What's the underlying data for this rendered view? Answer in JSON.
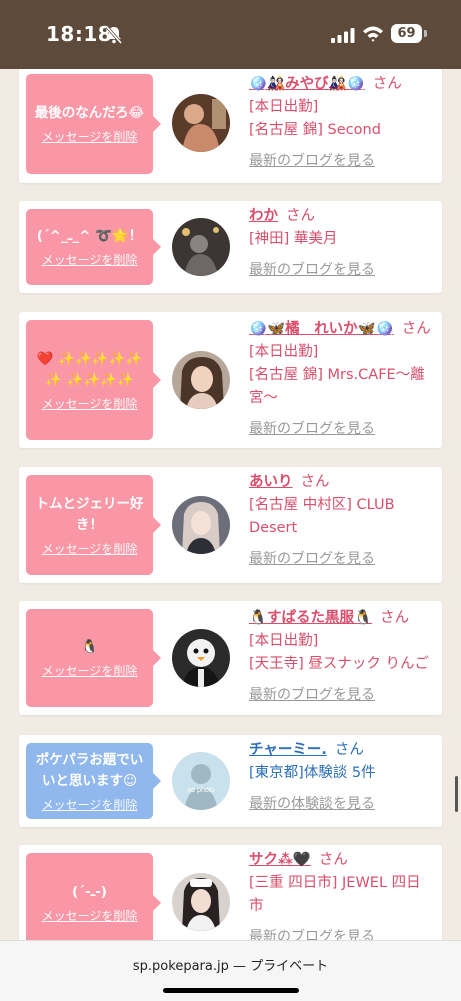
{
  "status_bar": {
    "time": "18:18",
    "battery": "69",
    "icons": [
      "bell-slash-icon",
      "signal-icon",
      "wifi-icon",
      "battery-icon"
    ]
  },
  "colors": {
    "header_bg": "#5e4a3a",
    "pink_bubble": "#fa97a6",
    "blue_bubble": "#90b8ec",
    "pink_text": "#d94f6c",
    "blue_text": "#2d6fb8"
  },
  "delete_label": "メッセージを削除",
  "san": "さん",
  "cards": [
    {
      "message": "最後のなんだろ😂",
      "name": "🪩🎎みやび🎎🪩",
      "lines": [
        "[本日出勤]",
        "[名古屋 錦] Second"
      ],
      "link": "最新のブログを見る"
    },
    {
      "message": "(´^_ـ_^ ➰🌟！",
      "name": "わか",
      "lines": [
        "[神田] 華美月"
      ],
      "link": "最新のブログを見る"
    },
    {
      "message": "❤️ ✨✨✨✨✨✨ ✨✨✨✨",
      "name": "🪩🦋橘　れいか🦋🪩",
      "lines": [
        "[本日出勤]",
        "[名古屋 錦] Mrs.CAFE〜離宮〜"
      ],
      "link": "最新のブログを見る"
    },
    {
      "message": "トムとジェリー好き！",
      "name": "あいり",
      "lines": [
        "[名古屋 中村区] CLUB Desert"
      ],
      "link": "最新のブログを見る"
    },
    {
      "message": "🐧",
      "name": "🐧すぱるた黒服🐧",
      "lines": [
        "[本日出勤]",
        "[天王寺] 昼スナック りんご"
      ],
      "link": "最新のブログを見る"
    },
    {
      "message": "ポケパラお題でいいと思います☺",
      "name": "チャーミー.",
      "lines": [
        "[東京都]体験談 5件"
      ],
      "link": "最新の体験談を見る",
      "avatar_text": "no photo"
    },
    {
      "message": "(´-ـ-)",
      "name": "サク⁂🖤",
      "lines": [
        "[三重 四日市] JEWEL 四日市"
      ],
      "link": "最新のブログを見る"
    }
  ],
  "bottom_bar": {
    "url": "sp.pokepara.jp — プライベート"
  }
}
